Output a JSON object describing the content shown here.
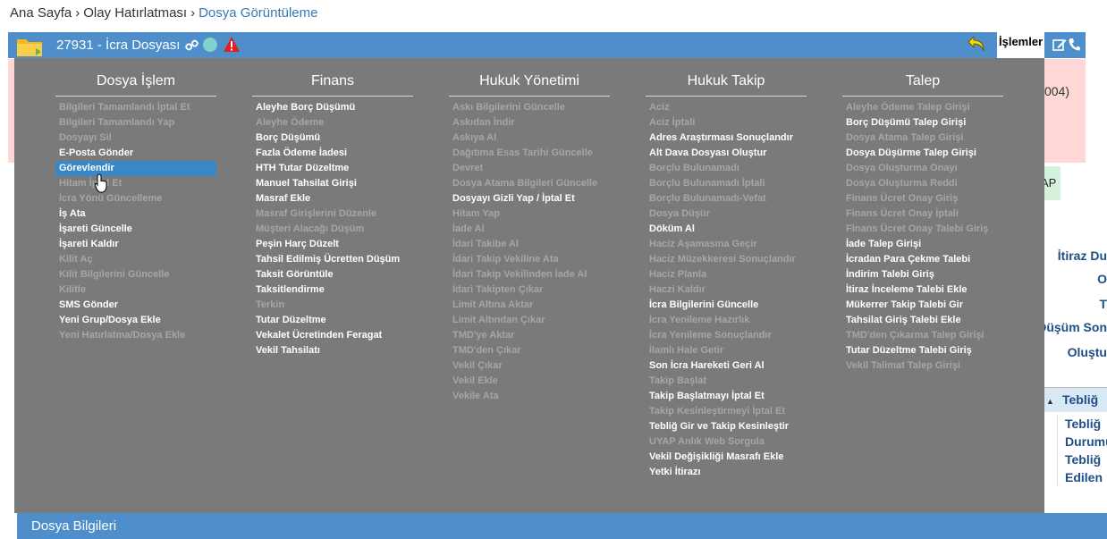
{
  "breadcrumb": {
    "items": [
      "Ana Sayfa",
      "Olay Hatırlatması",
      "Dosya Görüntüleme"
    ],
    "separator": "›"
  },
  "header": {
    "file_title": "27931 - İcra Dosyası",
    "islemler_label": "İşlemler",
    "icons": [
      "folder-icon",
      "link-icon",
      "status-dot",
      "warning-icon",
      "back-icon",
      "edit-icon",
      "phone-icon"
    ],
    "bar_color": "#4e8fcb"
  },
  "background": {
    "pink_text": "004)",
    "green_tab_label": "AP",
    "right_labels": [
      "İtiraz Du",
      "O",
      "T",
      "Düşüm Son",
      "Oluştu"
    ],
    "teblig_header": "Tebliğ",
    "teblig_cell": [
      "Tebliğ",
      "Durumu",
      "Tebliğ",
      "Edilen"
    ],
    "footer_title": "Dosya Bilgileri"
  },
  "menu": {
    "columns": [
      {
        "title": "Dosya İşlem",
        "items": [
          {
            "label": "Bilgileri Tamamlandı İptal Et",
            "enabled": false
          },
          {
            "label": "Bilgileri Tamamlandı Yap",
            "enabled": false
          },
          {
            "label": "Dosyayı Sil",
            "enabled": false
          },
          {
            "label": "E-Posta Gönder",
            "enabled": true
          },
          {
            "label": "Görevlendir",
            "enabled": true,
            "selected": true
          },
          {
            "label": "Hitam İptal Et",
            "enabled": false
          },
          {
            "label": "İcra Yönü Güncelleme",
            "enabled": false
          },
          {
            "label": "İş Ata",
            "enabled": true
          },
          {
            "label": "İşareti Güncelle",
            "enabled": true
          },
          {
            "label": "İşareti Kaldır",
            "enabled": true
          },
          {
            "label": "Kilit Aç",
            "enabled": false
          },
          {
            "label": "Kilit Bilgilerini Güncelle",
            "enabled": false
          },
          {
            "label": "Kilitle",
            "enabled": false
          },
          {
            "label": "SMS Gönder",
            "enabled": true
          },
          {
            "label": "Yeni Grup/Dosya Ekle",
            "enabled": true
          },
          {
            "label": "Yeni Hatırlatma/Dosya Ekle",
            "enabled": false
          }
        ]
      },
      {
        "title": "Finans",
        "items": [
          {
            "label": "Aleyhe Borç Düşümü",
            "enabled": true
          },
          {
            "label": "Aleyhe Ödeme",
            "enabled": false
          },
          {
            "label": "Borç Düşümü",
            "enabled": true
          },
          {
            "label": "Fazla Ödeme İadesi",
            "enabled": true
          },
          {
            "label": "HTH Tutar Düzeltme",
            "enabled": true
          },
          {
            "label": "Manuel Tahsilat Girişi",
            "enabled": true
          },
          {
            "label": "Masraf Ekle",
            "enabled": true
          },
          {
            "label": "Masraf Girişlerini Düzenle",
            "enabled": false
          },
          {
            "label": "Müşteri Alacağı Düşüm",
            "enabled": false
          },
          {
            "label": "Peşin Harç Düzelt",
            "enabled": true
          },
          {
            "label": "Tahsil Edilmiş Ücretten Düşüm",
            "enabled": true
          },
          {
            "label": "Taksit Görüntüle",
            "enabled": true
          },
          {
            "label": "Taksitlendirme",
            "enabled": true
          },
          {
            "label": "Terkin",
            "enabled": false
          },
          {
            "label": "Tutar Düzeltme",
            "enabled": true
          },
          {
            "label": "Vekalet Ücretinden Feragat",
            "enabled": true
          },
          {
            "label": "Vekil Tahsilatı",
            "enabled": true
          }
        ]
      },
      {
        "title": "Hukuk Yönetimi",
        "items": [
          {
            "label": "Askı Bilgilerini Güncelle",
            "enabled": false
          },
          {
            "label": "Askıdan İndir",
            "enabled": false
          },
          {
            "label": "Askıya Al",
            "enabled": false
          },
          {
            "label": "Dağıtıma Esas Tarihi Güncelle",
            "enabled": false
          },
          {
            "label": "Devret",
            "enabled": false
          },
          {
            "label": "Dosya Atama Bilgileri Güncelle",
            "enabled": false
          },
          {
            "label": "Dosyayı Gizli Yap / İptal Et",
            "enabled": true
          },
          {
            "label": "Hitam Yap",
            "enabled": false
          },
          {
            "label": "İade Al",
            "enabled": false
          },
          {
            "label": "İdari Takibe Al",
            "enabled": false
          },
          {
            "label": "İdari Takip Vekiline Ata",
            "enabled": false
          },
          {
            "label": "İdari Takip Vekilinden İade Al",
            "enabled": false
          },
          {
            "label": "İdari Takipten Çıkar",
            "enabled": false
          },
          {
            "label": "Limit Altına Aktar",
            "enabled": false
          },
          {
            "label": "Limit Altından Çıkar",
            "enabled": false
          },
          {
            "label": "TMD'ye Aktar",
            "enabled": false
          },
          {
            "label": "TMD'den Çıkar",
            "enabled": false
          },
          {
            "label": "Vekil Çıkar",
            "enabled": false
          },
          {
            "label": "Vekil Ekle",
            "enabled": false
          },
          {
            "label": "Vekile Ata",
            "enabled": false
          }
        ]
      },
      {
        "title": "Hukuk Takip",
        "items": [
          {
            "label": "Aciz",
            "enabled": false
          },
          {
            "label": "Aciz İptali",
            "enabled": false
          },
          {
            "label": "Adres Araştırması Sonuçlandır",
            "enabled": true
          },
          {
            "label": "Alt Dava Dosyası Oluştur",
            "enabled": true
          },
          {
            "label": "Borçlu Bulunamadı",
            "enabled": false
          },
          {
            "label": "Borçlu Bulunamadı İptali",
            "enabled": false
          },
          {
            "label": "Borçlu Bulunamadı-Vefat",
            "enabled": false
          },
          {
            "label": "Dosya Düşür",
            "enabled": false
          },
          {
            "label": "Döküm Al",
            "enabled": true
          },
          {
            "label": "Haciz Aşamasına Geçir",
            "enabled": false
          },
          {
            "label": "Haciz Müzekkeresi Sonuçlandır",
            "enabled": false
          },
          {
            "label": "Haciz Planla",
            "enabled": false
          },
          {
            "label": "Haczi Kaldır",
            "enabled": false
          },
          {
            "label": "İcra Bilgilerini Güncelle",
            "enabled": true
          },
          {
            "label": "İcra Yenileme Hazırlık",
            "enabled": false
          },
          {
            "label": "İcra Yenileme Sonuçlandır",
            "enabled": false
          },
          {
            "label": "İlamlı Hale Getir",
            "enabled": false
          },
          {
            "label": "Son İcra Hareketi Geri Al",
            "enabled": true
          },
          {
            "label": "Takip Başlat",
            "enabled": false
          },
          {
            "label": "Takip Başlatmayı İptal Et",
            "enabled": true
          },
          {
            "label": "Takip Kesinleştirmeyi İptal Et",
            "enabled": false
          },
          {
            "label": "Tebliğ Gir ve Takip Kesinleştir",
            "enabled": true
          },
          {
            "label": "UYAP Anlık Web Sorgula",
            "enabled": false
          },
          {
            "label": "Vekil Değişikliği Masrafı Ekle",
            "enabled": true
          },
          {
            "label": "Yetki İtirazı",
            "enabled": true
          }
        ]
      },
      {
        "title": "Talep",
        "items": [
          {
            "label": "Aleyhe Ödeme Talep Girişi",
            "enabled": false
          },
          {
            "label": "Borç Düşümü Talep Girişi",
            "enabled": true
          },
          {
            "label": "Dosya Atama Talep Girişi",
            "enabled": false
          },
          {
            "label": "Dosya Düşürme Talep Girişi",
            "enabled": true
          },
          {
            "label": "Dosya Oluşturma Onayı",
            "enabled": false
          },
          {
            "label": "Dosya Oluşturma Reddi",
            "enabled": false
          },
          {
            "label": "Finans Ücret Onay Giriş",
            "enabled": false
          },
          {
            "label": "Finans Ücret Onay İptali",
            "enabled": false
          },
          {
            "label": "Finans Ücret Onay Talebi Giriş",
            "enabled": false
          },
          {
            "label": "İade Talep Girişi",
            "enabled": true
          },
          {
            "label": "İcradan Para Çekme Talebi",
            "enabled": true
          },
          {
            "label": "İndirim Talebi Giriş",
            "enabled": true
          },
          {
            "label": "İtiraz İnceleme Talebi Ekle",
            "enabled": true
          },
          {
            "label": "Mükerrer Takip Talebi Gir",
            "enabled": true
          },
          {
            "label": "Tahsilat Giriş Talebi Ekle",
            "enabled": true
          },
          {
            "label": "TMD'den Çıkarma Talep Girişi",
            "enabled": false
          },
          {
            "label": "Tutar Düzeltme Talebi Giriş",
            "enabled": true
          },
          {
            "label": "Vekil Talimat Talep Girişi",
            "enabled": false
          }
        ]
      }
    ]
  }
}
